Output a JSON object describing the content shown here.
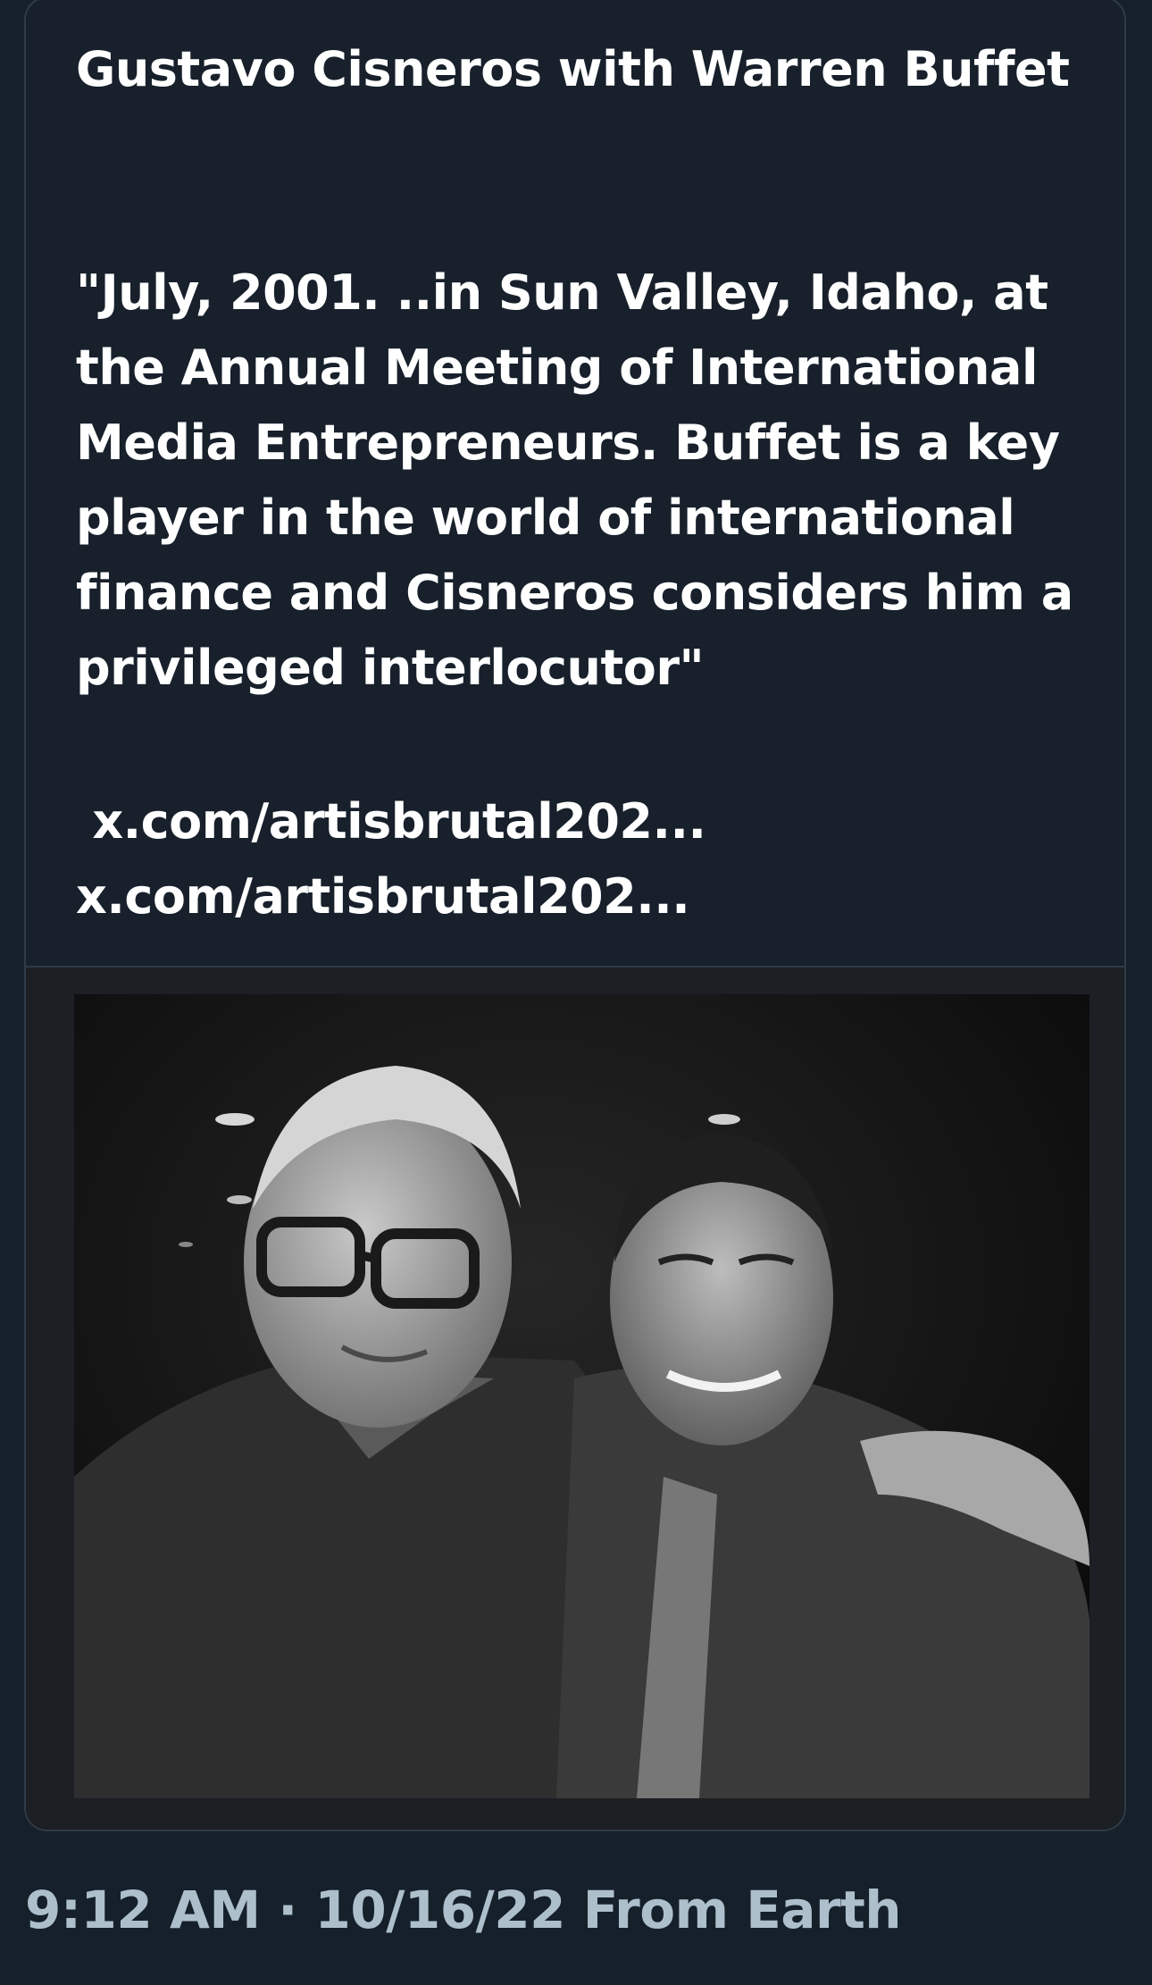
{
  "quoted_tweet": {
    "title": "Gustavo Cisneros with Warren Buffet",
    "body": "\"July, 2001. ..in Sun Valley, Idaho, at the Annual Meeting of International Media Entrepreneurs. Buffet is a key player in the world of international finance and Cisneros considers him a privileged interlocutor\"",
    "links": [
      "x.com/artisbrutal202...",
      "x.com/artisbrutal202..."
    ]
  },
  "tweet_meta": {
    "time": "9:12 AM",
    "separator": "·",
    "date": "10/16/22",
    "source": "From Earth"
  },
  "colors": {
    "background": "#15202b",
    "text": "#ffffff",
    "meta_text": "#aebfcc",
    "card_border": "#2f3b47"
  }
}
